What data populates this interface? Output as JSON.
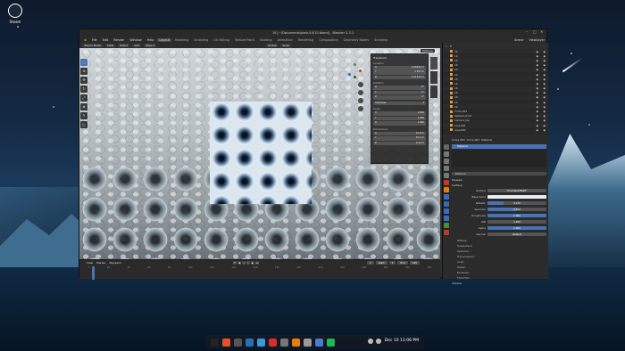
{
  "desktop": {
    "steam_label": "Steam",
    "taskbar": {
      "clock": "Dec 10 11:06 PM",
      "apps": [
        "app-launcher",
        "brave-browser",
        "file-manager",
        "finder",
        "photos",
        "youtube",
        "calculator",
        "blender",
        "tools",
        "files",
        "spotify"
      ]
    }
  },
  "window": {
    "title": "10 [~/Documents/pack/10/10.blend] - Blender 3.3.1",
    "menu": [
      "File",
      "Edit",
      "Render",
      "Window",
      "Help"
    ],
    "workspaces": [
      "Layout",
      "Modeling",
      "Sculpting",
      "UV Editing",
      "Texture Paint",
      "Shading",
      "Animation",
      "Rendering",
      "Compositing",
      "Geometry Nodes",
      "Scripting"
    ],
    "active_workspace": "Layout",
    "scene_label": "Scene",
    "viewlayer_label": "ViewLayer"
  },
  "viewport": {
    "header": [
      "Object Mode",
      "View",
      "Select",
      "Add",
      "Object"
    ],
    "transform_header": [
      "Global",
      "Snap"
    ],
    "options": "Options",
    "npanel": {
      "title": "Transform",
      "location_label": "Location",
      "location": [
        [
          "X",
          "0.40452 m"
        ],
        [
          "Y",
          "1.977 m"
        ],
        [
          "Z",
          "0.21415 m"
        ]
      ],
      "rotation_label": "Rotation",
      "rotation": [
        [
          "X",
          "0°"
        ],
        [
          "Y",
          "0°"
        ],
        [
          "Z",
          "0°"
        ]
      ],
      "mode": "XYZ Euler",
      "scale_label": "Scale",
      "scale": [
        [
          "X",
          "1.000"
        ],
        [
          "Y",
          "1.000"
        ],
        [
          "Z",
          "1.000"
        ]
      ],
      "dimensions_label": "Dimensions",
      "dimensions": [
        [
          "X",
          "41.8 m"
        ],
        [
          "Y",
          "41.1 m"
        ],
        [
          "Z",
          "9.15 m"
        ]
      ]
    }
  },
  "timeline": {
    "menu": [
      "View",
      "Marker",
      "Playback"
    ],
    "start_label": "Start",
    "start": "1",
    "end_label": "End",
    "end": "250",
    "current": "1",
    "ruler": [
      "0",
      "20",
      "40",
      "60",
      "80",
      "100",
      "120",
      "140",
      "160",
      "180",
      "200",
      "220",
      "240",
      "260",
      "280",
      "300",
      "320"
    ]
  },
  "outliner": {
    "items": [
      "10",
      "10",
      "10",
      "10",
      "10",
      "10",
      "10",
      "10",
      "10",
      "10",
      "10",
      "10",
      "10",
      "Circle.003",
      "Camera_front",
      "Camera_top",
      "Area.001",
      "Area.002"
    ]
  },
  "properties": {
    "object": "Circle.003",
    "data": "Circle.003",
    "material_tab": "Material",
    "material_slot": "Material",
    "material_name": "Material",
    "preview": "Preview",
    "surface": "Surface",
    "surface_shader": "Principled BSDF",
    "inputs": [
      {
        "label": "Base Color",
        "value": "",
        "fill": 0
      },
      {
        "label": "Metallic",
        "value": "0.270",
        "fill": 0.27
      },
      {
        "label": "Specular",
        "value": "0.500",
        "fill": 0.5
      },
      {
        "label": "Roughness",
        "value": "1.000",
        "fill": 1.0
      },
      {
        "label": "IOR",
        "value": "1.450",
        "fill": 0.0
      },
      {
        "label": "Alpha",
        "value": "1.000",
        "fill": 1.0
      },
      {
        "label": "Normal",
        "value": "Default",
        "fill": 0
      }
    ],
    "sections": [
      "Diffuse",
      "Subsurface",
      "Specular",
      "Transmission",
      "Coat",
      "Sheen",
      "Emission",
      "Thin Film"
    ],
    "volume": "Volume"
  }
}
